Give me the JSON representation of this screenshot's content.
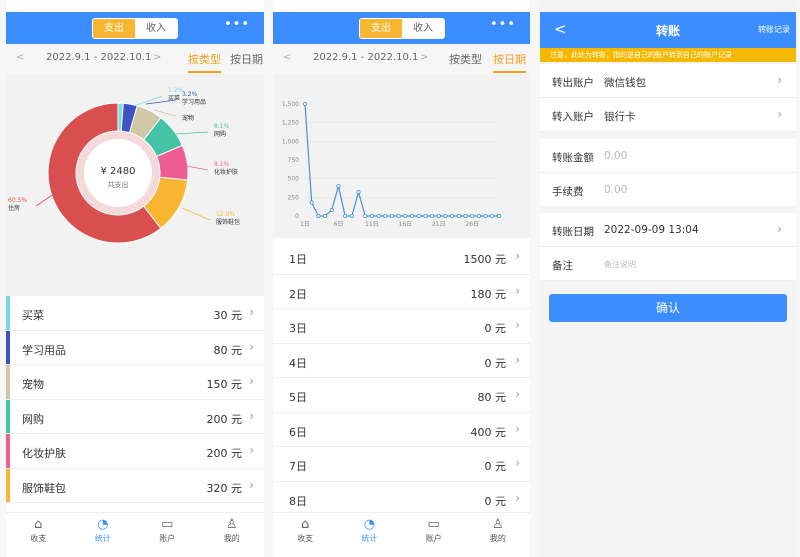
{
  "stats_by_type": {
    "toggle": {
      "expense": "支出",
      "income": "收入"
    },
    "more": "•••",
    "date_range": "2022.9.1 - 2022.10.1",
    "prev": "<",
    "next": ">",
    "tab_by_type": "按类型",
    "tab_by_day": "按日期",
    "donut": {
      "total": "¥ 2480",
      "total_label": "共支出",
      "labels": [
        {
          "pct": "1.2%",
          "name": "买菜"
        },
        {
          "pct": "3.2%",
          "name": "学习用品"
        },
        {
          "pct": "",
          "name": "宠物"
        },
        {
          "pct": "8.1%",
          "name": "网购"
        },
        {
          "pct": "8.1%",
          "name": "化妆护肤"
        },
        {
          "pct": "12.9%",
          "name": "服饰鞋包"
        },
        {
          "pct": "60.5%",
          "name": "住房"
        }
      ]
    },
    "chart_data": {
      "type": "pie",
      "categories": [
        "买菜",
        "学习用品",
        "宠物",
        "网购",
        "化妆护肤",
        "服饰鞋包",
        "住房"
      ],
      "values": [
        30,
        80,
        150,
        200,
        200,
        320,
        1500
      ],
      "colors": [
        "#7bd8e8",
        "#3f52c4",
        "#cfc7a6",
        "#44c3a6",
        "#ee5e93",
        "#f8b531",
        "#d94f4f"
      ]
    },
    "categories": [
      {
        "name": "买菜",
        "amount": "30 元",
        "color": "#7bd8e8"
      },
      {
        "name": "学习用品",
        "amount": "80 元",
        "color": "#3f52c4"
      },
      {
        "name": "宠物",
        "amount": "150 元",
        "color": "#cfc7a6"
      },
      {
        "name": "网购",
        "amount": "200 元",
        "color": "#44c3a6"
      },
      {
        "name": "化妆护肤",
        "amount": "200 元",
        "color": "#ee5e93"
      },
      {
        "name": "服饰鞋包",
        "amount": "320 元",
        "color": "#f8b531"
      }
    ]
  },
  "stats_by_day": {
    "toggle": {
      "expense": "支出",
      "income": "收入"
    },
    "more": "•••",
    "date_range": "2022.9.1 - 2022.10.1",
    "tab_by_type": "按类型",
    "tab_by_day": "按日期",
    "chart_data": {
      "type": "line",
      "y_ticks": [
        "1,500",
        "1,250",
        "1,000",
        "750",
        "500",
        "250",
        "0"
      ],
      "x_ticks": [
        "1日",
        "6日",
        "11日",
        "16日",
        "21日",
        "26日"
      ],
      "x": [
        1,
        2,
        3,
        4,
        5,
        6,
        7,
        8,
        9,
        10,
        11,
        12,
        13,
        14,
        15,
        16,
        17,
        18,
        19,
        20,
        21,
        22,
        23,
        24,
        25,
        26,
        27,
        28,
        29,
        30
      ],
      "values": [
        1500,
        180,
        0,
        0,
        80,
        400,
        0,
        0,
        320,
        0,
        0,
        0,
        0,
        0,
        0,
        0,
        0,
        0,
        0,
        0,
        0,
        0,
        0,
        0,
        0,
        0,
        0,
        0,
        0,
        0
      ],
      "ylim": [
        0,
        1500
      ]
    },
    "days": [
      {
        "day": "1日",
        "amount": "1500 元"
      },
      {
        "day": "2日",
        "amount": "180 元"
      },
      {
        "day": "3日",
        "amount": "0 元"
      },
      {
        "day": "4日",
        "amount": "0 元"
      },
      {
        "day": "5日",
        "amount": "80 元"
      },
      {
        "day": "6日",
        "amount": "400 元"
      },
      {
        "day": "7日",
        "amount": "0 元"
      },
      {
        "day": "8日",
        "amount": "0 元"
      }
    ]
  },
  "tabbar": [
    {
      "label": "收支",
      "icon": "wallet-icon"
    },
    {
      "label": "统计",
      "icon": "clock-chart-icon"
    },
    {
      "label": "账户",
      "icon": "card-icon"
    },
    {
      "label": "我的",
      "icon": "user-icon"
    }
  ],
  "transfer": {
    "back": "<",
    "title": "转账",
    "records": "转账记录",
    "notice": "注意，此处为转账，指的是自己的账户转到自己的账户记录",
    "out_label": "转出账户",
    "out_value": "微信钱包",
    "in_label": "转入账户",
    "in_value": "银行卡",
    "amount_label": "转账金额",
    "amount_placeholder": "0.00",
    "fee_label": "手续费",
    "fee_placeholder": "0.00",
    "date_label": "转账日期",
    "date_value": "2022-09-09 13:04",
    "note_label": "备注",
    "note_placeholder": "备注说明",
    "confirm": "确认"
  }
}
